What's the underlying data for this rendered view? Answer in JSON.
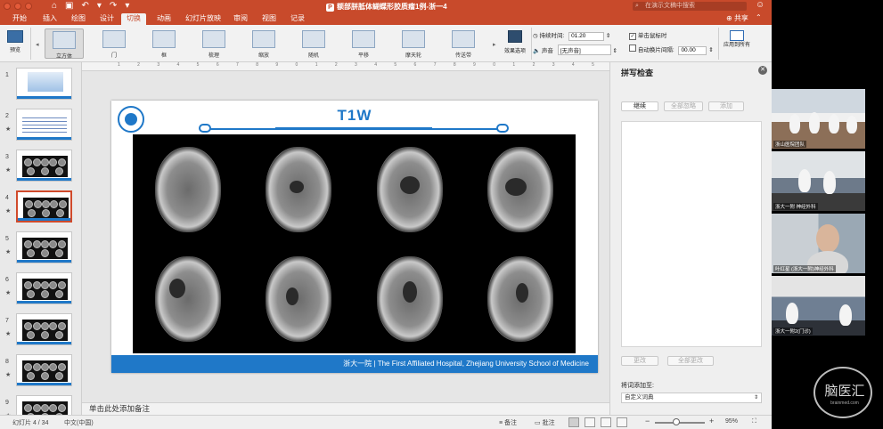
{
  "window": {
    "title": "额部胼胝体蝴蝶形胶质瘤1例-浙一4",
    "search_placeholder": "在演示文稿中搜索",
    "share_label": "共享"
  },
  "tabs": [
    "开始",
    "插入",
    "绘图",
    "设计",
    "切换",
    "动画",
    "幻灯片放映",
    "审阅",
    "视图",
    "记录"
  ],
  "active_tab": "切换",
  "ribbon": {
    "preview_label": "预览",
    "transitions": [
      {
        "label": "立方体",
        "selected": true
      },
      {
        "label": "门"
      },
      {
        "label": "框"
      },
      {
        "label": "梳理"
      },
      {
        "label": "缩放"
      },
      {
        "label": "随机"
      },
      {
        "label": "平移"
      },
      {
        "label": "摩天轮"
      },
      {
        "label": "传送带"
      }
    ],
    "effect_options_label": "效果选项",
    "duration_label": "持续时间:",
    "duration_value": "01.20",
    "sound_label": "声音",
    "sound_value": "[无声音]",
    "on_click_label": "单击鼠标时",
    "on_click_checked": true,
    "auto_after_label": "自动换片间隔:",
    "auto_after_value": "00.00",
    "apply_all_label": "应用到所有"
  },
  "thumbnails": [
    {
      "num": "1",
      "kind": "title"
    },
    {
      "num": "2",
      "kind": "text"
    },
    {
      "num": "3",
      "kind": "mri"
    },
    {
      "num": "4",
      "kind": "mri",
      "selected": true
    },
    {
      "num": "5",
      "kind": "mri"
    },
    {
      "num": "6",
      "kind": "mri"
    },
    {
      "num": "7",
      "kind": "mri"
    },
    {
      "num": "8",
      "kind": "mri"
    },
    {
      "num": "9",
      "kind": "mri"
    }
  ],
  "slide": {
    "title": "T1W",
    "footer": "浙大一院 | The First Affiliated Hospital, Zhejiang University School of Medicine",
    "scans": [
      "axial-1",
      "axial-2",
      "axial-3",
      "axial-4",
      "axial-5",
      "axial-6",
      "axial-7",
      "axial-8"
    ]
  },
  "notes_placeholder": "单击此处添加备注",
  "statusbar": {
    "slide_info": "幻灯片 4 / 34",
    "language": "中文(中国)",
    "notes_label": "备注",
    "comments_label": "批注",
    "zoom_minus": "−",
    "zoom_plus": "+",
    "zoom": "95%",
    "zoom_fraction": 0.42
  },
  "spelling": {
    "title": "拼写检查",
    "resume_label": "继续",
    "ignore_all_label": "全部忽略",
    "add_label": "添加",
    "change_label": "更改",
    "change_all_label": "全部更改",
    "add_to_label": "将词添加至:",
    "dictionary_value": "自定义词典"
  },
  "video": {
    "participants": [
      {
        "name": "浙山医院团队"
      },
      {
        "name": "浙大一附 神经外科"
      },
      {
        "name": "叶红星 (浙大一附)神经外科"
      },
      {
        "name": "浙大一附2(门诊)"
      }
    ],
    "watermark": "脑医汇",
    "watermark_sub": "brainmed.com"
  }
}
